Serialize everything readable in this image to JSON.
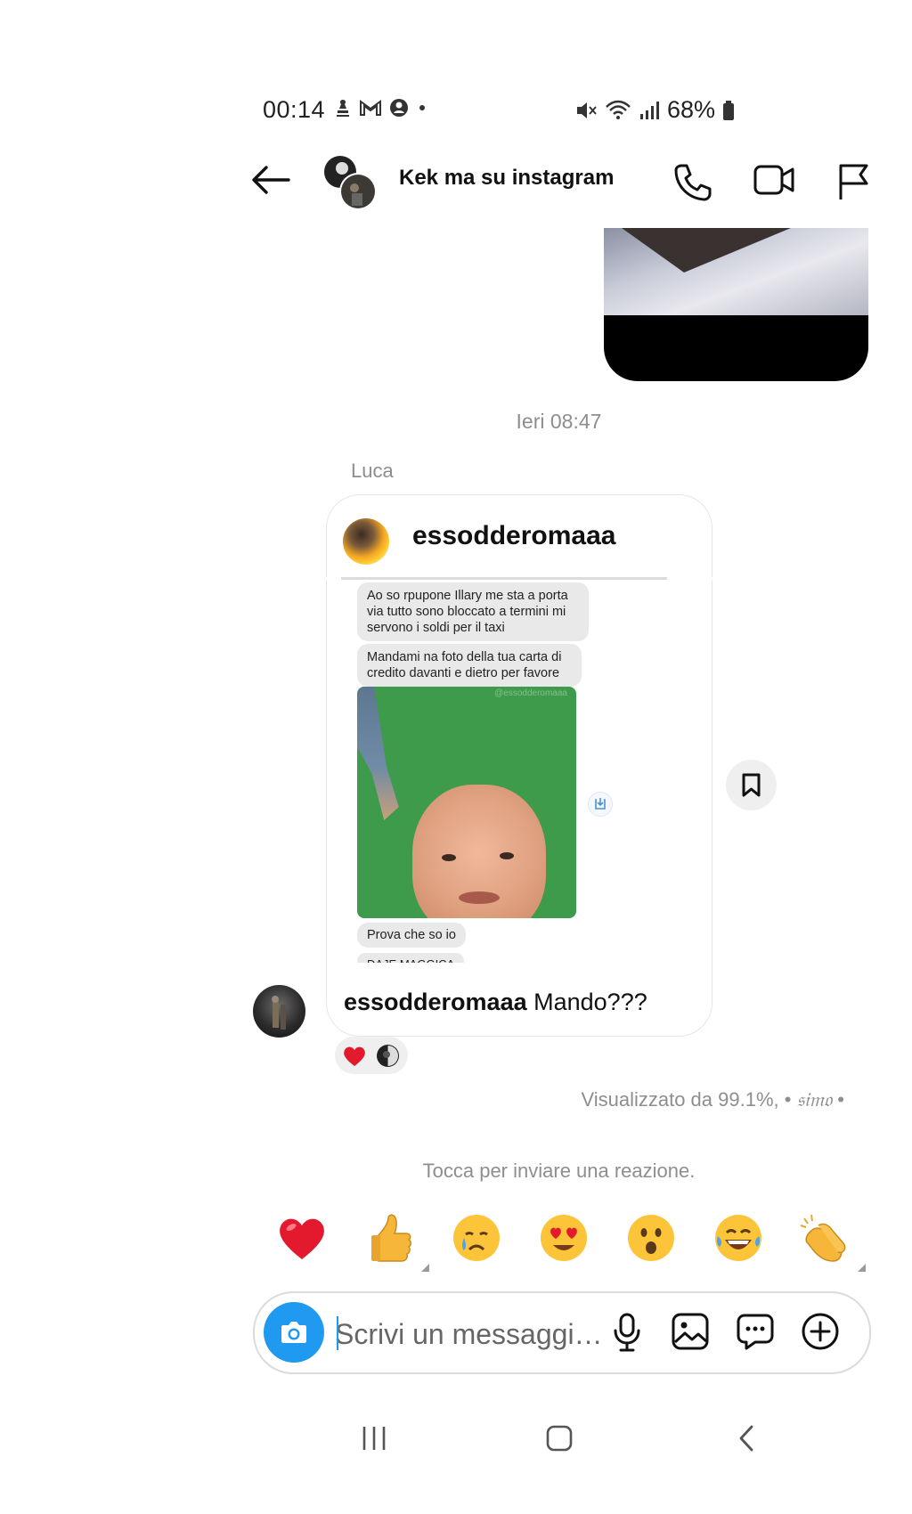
{
  "status_bar": {
    "time": "00:14",
    "battery": "68%"
  },
  "header": {
    "title": "Kek ma su instagram"
  },
  "thread": {
    "timestamp": "Ieri 08:47",
    "sender_name": "Luca",
    "shared_post": {
      "username": "essodderomaaa",
      "screenshot_bubbles": [
        "Ao so rpupone Illary me sta a porta via tutto sono bloccato a termini mi servono i soldi per il taxi",
        "Mandami na foto della tua carta di credito davanti e dietro per favore",
        "Prova che so io",
        "DAJE MAGGICA"
      ],
      "watermark": "@essodderomaaa",
      "caption_user": "essodderomaaa",
      "caption_text": "Mando???"
    },
    "reactions": [
      "heart",
      "avatar"
    ],
    "seen_prefix": "Visualizzato da 99.1%, •",
    "seen_name": "𝔰𝔦𝔪𝔬",
    "seen_suffix": "•"
  },
  "reaction_hint": "Tocca per inviare una reazione.",
  "quick_reactions": [
    "❤️",
    "👍",
    "😢",
    "😍",
    "😮",
    "😂",
    "👏"
  ],
  "composer": {
    "placeholder": "Scrivi un messaggi…"
  },
  "colors": {
    "accent": "#1f9af0",
    "muted_text": "#8e8e8e",
    "bubble_bg": "#e9e9e9"
  }
}
